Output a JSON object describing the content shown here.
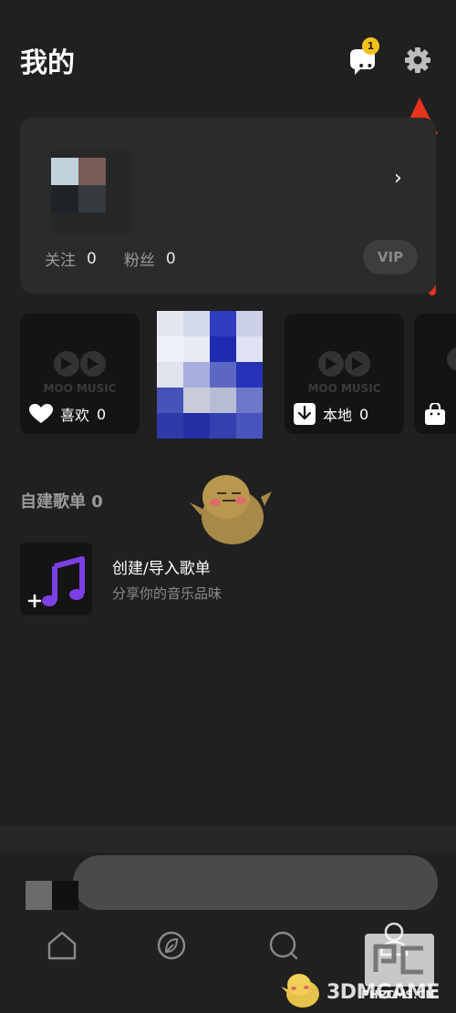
{
  "header": {
    "title": "我的",
    "message_badge": "1"
  },
  "profile": {
    "follow_label": "关注",
    "follow_count": "0",
    "fans_label": "粉丝",
    "fans_count": "0",
    "vip_label": "VIP",
    "chevron": "›"
  },
  "tiles": [
    {
      "logo_text": "MOO MUSIC",
      "label": "喜欢",
      "count": "0",
      "icon": "heart-icon"
    },
    {
      "logo_text": "MOO MUSIC",
      "label": "本地",
      "count": "0",
      "icon": "download-icon"
    },
    {
      "icon": "bag-icon"
    }
  ],
  "playlists": {
    "section_title": "自建歌单 0",
    "create_title": "创建/导入歌单",
    "create_subtitle": "分享你的音乐品味"
  },
  "tabbar": {
    "items": [
      {
        "icon": "home-icon"
      },
      {
        "icon": "discover-icon"
      },
      {
        "icon": "search-icon"
      },
      {
        "icon": "profile-icon"
      }
    ]
  },
  "watermarks": {
    "site1": "PHPCMS.CN",
    "site2": "3DMGAME"
  },
  "colors": {
    "accent": "#f4c21d",
    "arrow": "#e8331c",
    "note": "#7b3fe4",
    "background": "#202020"
  }
}
